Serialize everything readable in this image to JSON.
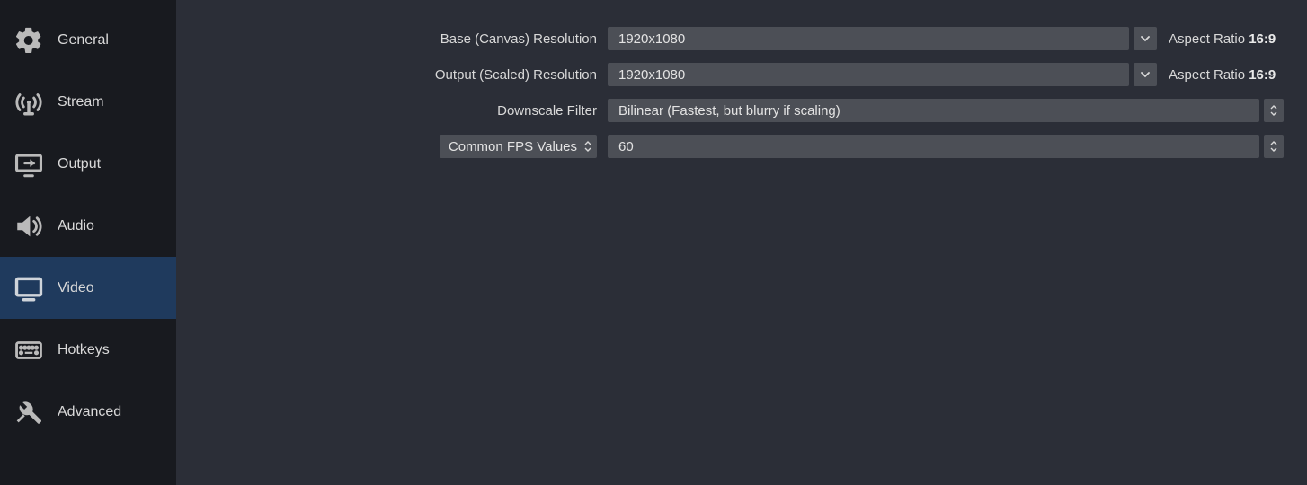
{
  "sidebar": {
    "items": [
      {
        "key": "general",
        "label": "General",
        "selected": false
      },
      {
        "key": "stream",
        "label": "Stream",
        "selected": false
      },
      {
        "key": "output",
        "label": "Output",
        "selected": false
      },
      {
        "key": "audio",
        "label": "Audio",
        "selected": false
      },
      {
        "key": "video",
        "label": "Video",
        "selected": true
      },
      {
        "key": "hotkeys",
        "label": "Hotkeys",
        "selected": false
      },
      {
        "key": "advanced",
        "label": "Advanced",
        "selected": false
      }
    ]
  },
  "video": {
    "base_label": "Base (Canvas) Resolution",
    "base_value": "1920x1080",
    "base_aspect_label": "Aspect Ratio",
    "base_aspect_value": "16:9",
    "output_label": "Output (Scaled) Resolution",
    "output_value": "1920x1080",
    "output_aspect_label": "Aspect Ratio",
    "output_aspect_value": "16:9",
    "downscale_label": "Downscale Filter",
    "downscale_value": "Bilinear (Fastest, but blurry if scaling)",
    "fps_type_label": "Common FPS Values",
    "fps_value": "60"
  }
}
